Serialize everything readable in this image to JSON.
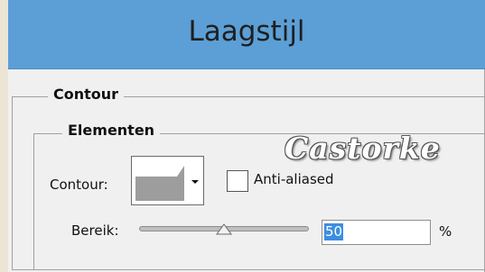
{
  "window": {
    "title": "Laagstijl"
  },
  "section": {
    "title": "Contour"
  },
  "group": {
    "title": "Elementen"
  },
  "contour": {
    "label": "Contour:"
  },
  "anti_aliased": {
    "label": "Anti-aliased",
    "checked": false
  },
  "range": {
    "label": "Bereik:",
    "value": "50",
    "unit": "%",
    "slider_percent": 50
  },
  "watermark": {
    "text": "Castorke"
  },
  "icons": {
    "dropdown": "chevron-down-icon",
    "slider": "slider-thumb-icon"
  }
}
